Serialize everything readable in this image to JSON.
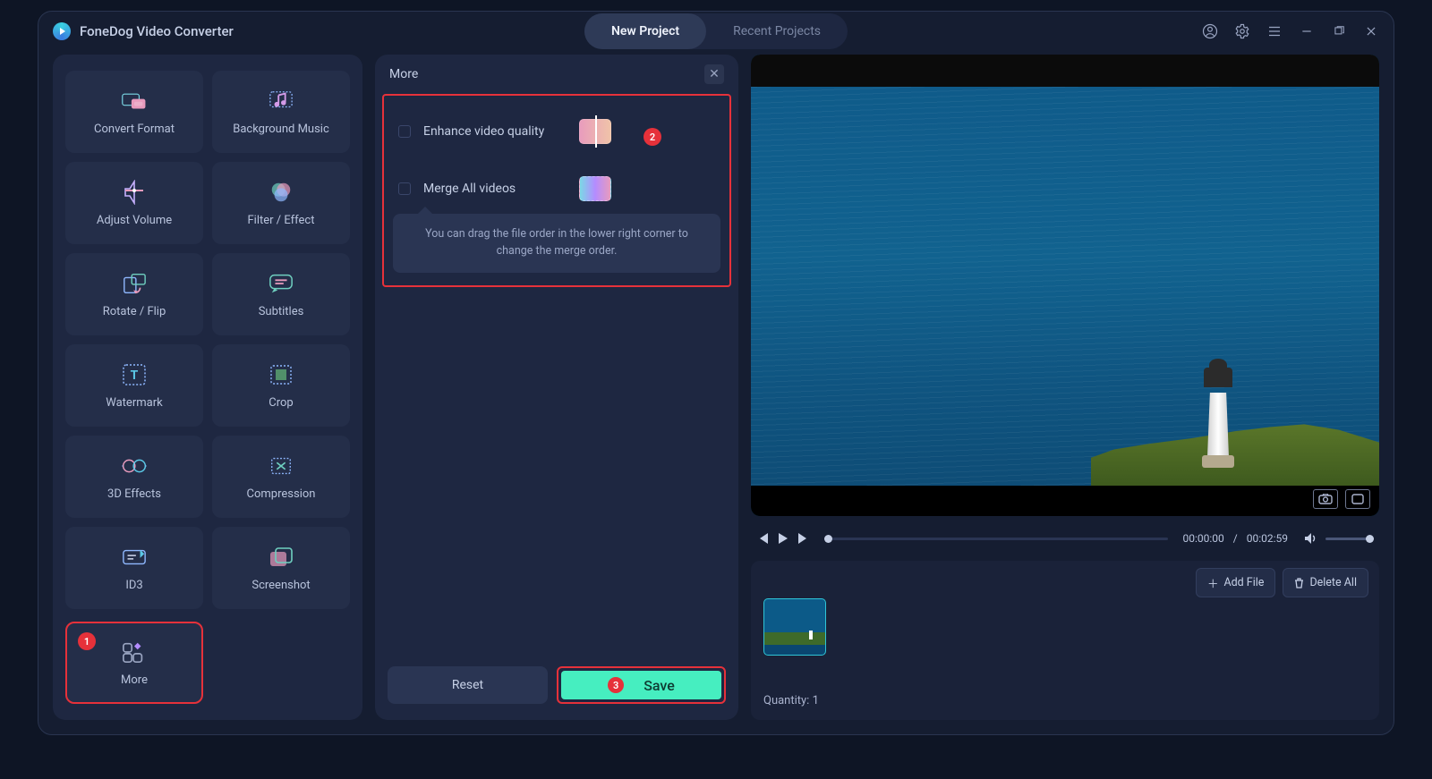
{
  "app": {
    "title": "FoneDog Video Converter"
  },
  "tabs": {
    "new": "New Project",
    "recent": "Recent Projects"
  },
  "tools": [
    {
      "key": "convert",
      "label": "Convert Format"
    },
    {
      "key": "bgm",
      "label": "Background Music"
    },
    {
      "key": "volume",
      "label": "Adjust Volume"
    },
    {
      "key": "filter",
      "label": "Filter / Effect"
    },
    {
      "key": "rotate",
      "label": "Rotate / Flip"
    },
    {
      "key": "subtitles",
      "label": "Subtitles"
    },
    {
      "key": "watermark",
      "label": "Watermark"
    },
    {
      "key": "crop",
      "label": "Crop"
    },
    {
      "key": "3d",
      "label": "3D Effects"
    },
    {
      "key": "compress",
      "label": "Compression"
    },
    {
      "key": "id3",
      "label": "ID3"
    },
    {
      "key": "screenshot",
      "label": "Screenshot"
    }
  ],
  "tool_more": {
    "label": "More"
  },
  "more_panel": {
    "title": "More",
    "enhance_label": "Enhance video quality",
    "merge_label": "Merge All videos",
    "merge_hint": "You can drag the file order in the lower right corner to change the merge order.",
    "reset": "Reset",
    "save": "Save"
  },
  "annotations": {
    "step1": "1",
    "step2": "2",
    "step3": "3"
  },
  "player": {
    "current": "00:00:00",
    "duration": "00:02:59",
    "sep": " / "
  },
  "files": {
    "add": "Add File",
    "delete": "Delete All",
    "quantity_label": "Quantity:",
    "quantity_value": "1"
  }
}
